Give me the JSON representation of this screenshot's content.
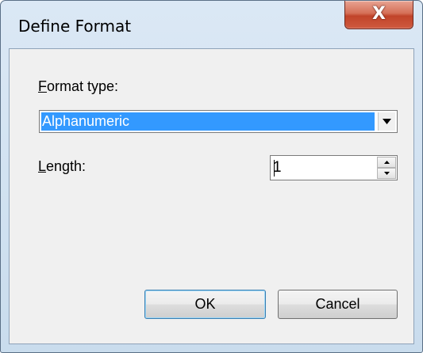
{
  "window": {
    "title": "Define Format",
    "close_glyph": "X"
  },
  "format_type": {
    "label_mnemonic": "F",
    "label_rest": "ormat type:",
    "value": "Alphanumeric",
    "dropdown_icon": "chevron-down-icon"
  },
  "length": {
    "label_mnemonic": "L",
    "label_rest": "ength:",
    "value": "1"
  },
  "buttons": {
    "ok": "OK",
    "cancel": "Cancel"
  },
  "colors": {
    "selection": "#3399ff",
    "close_button": "#c1442a",
    "client_bg": "#f0f0f0"
  }
}
